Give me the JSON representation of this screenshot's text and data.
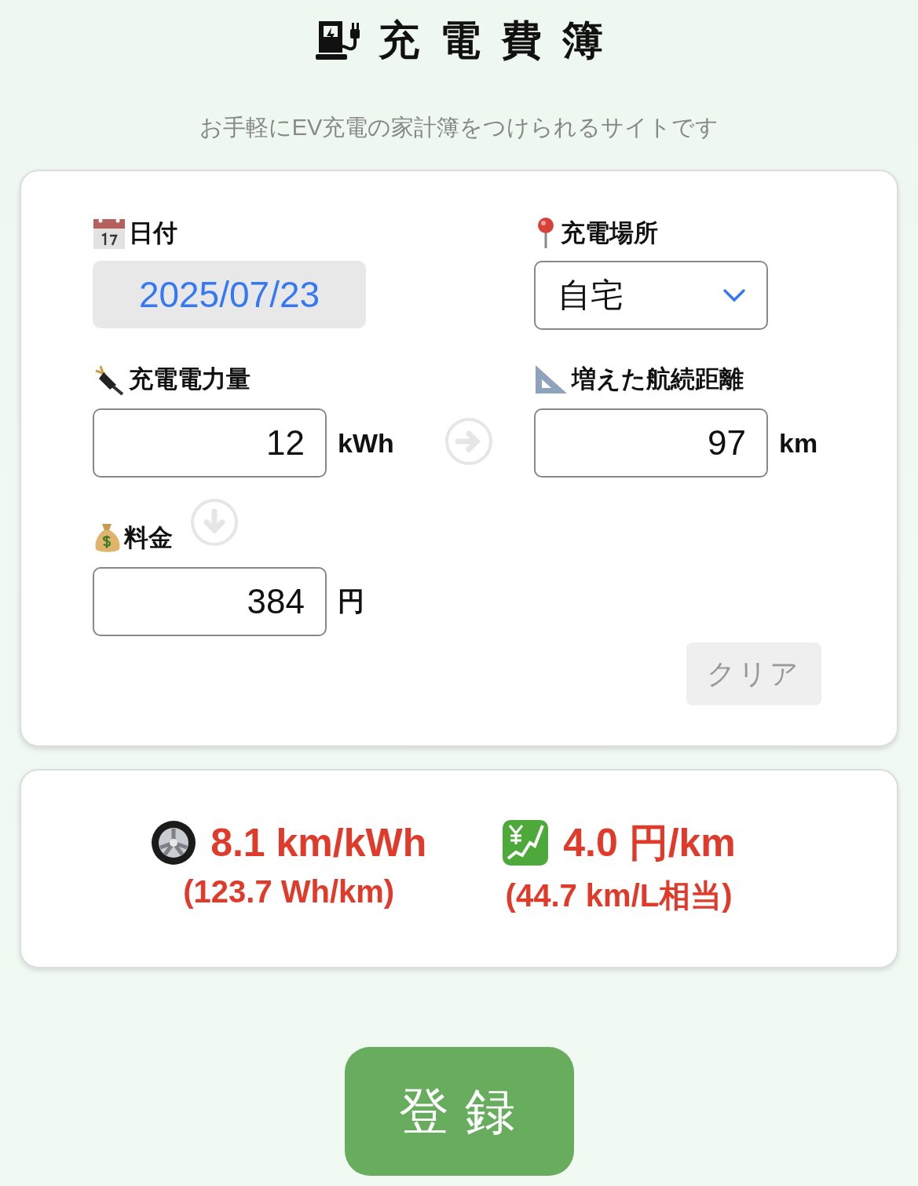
{
  "header": {
    "title": "充電費簿",
    "subtitle": "お手軽にEV充電の家計簿をつけられるサイトです"
  },
  "form": {
    "date": {
      "label": "日付",
      "value": "2025/07/23"
    },
    "place": {
      "label": "充電場所",
      "value": "自宅"
    },
    "energy": {
      "label": "充電電力量",
      "value": "12",
      "unit": "kWh"
    },
    "range": {
      "label": "増えた航続距離",
      "value": "97",
      "unit": "km"
    },
    "cost": {
      "label": "料金",
      "value": "384",
      "unit": "円"
    },
    "clear_button": "クリア"
  },
  "results": [
    {
      "value": "8.1 km/kWh",
      "detail": "(123.7 Wh/km)"
    },
    {
      "value": "4.0 円/km",
      "detail": "(44.7 km/L相当)"
    }
  ],
  "submit_button": "登録"
}
